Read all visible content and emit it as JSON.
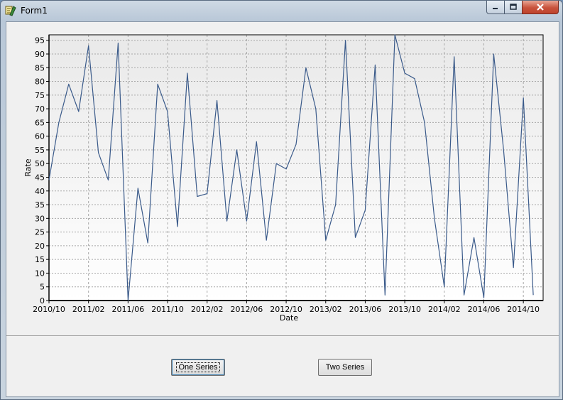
{
  "window": {
    "title": "Form1"
  },
  "buttons": {
    "one_series": "One Series",
    "two_series": "Two Series"
  },
  "colors": {
    "series": "#3a5a8a",
    "grid": "#a8a8a8",
    "plot_bg_top": "#e9e9e9",
    "plot_bg_bottom": "#ffffff"
  },
  "chart_data": {
    "type": "line",
    "title": "",
    "xlabel": "Date",
    "ylabel": "Rate",
    "ylim": [
      0,
      97
    ],
    "xlim": [
      "2010-10",
      "2014-12"
    ],
    "yticks": [
      0,
      5,
      10,
      15,
      20,
      25,
      30,
      35,
      40,
      45,
      50,
      55,
      60,
      65,
      70,
      75,
      80,
      85,
      90,
      95
    ],
    "xticks": [
      "2010/10",
      "2011/02",
      "2011/06",
      "2011/10",
      "2012/02",
      "2012/06",
      "2012/10",
      "2013/02",
      "2013/06",
      "2013/10",
      "2014/02",
      "2014/06",
      "2014/10"
    ],
    "grid": true,
    "legend": "none",
    "series": [
      {
        "x": [
          "2010-10",
          "2010-11",
          "2010-12",
          "2011-01",
          "2011-02",
          "2011-03",
          "2011-04",
          "2011-05",
          "2011-06",
          "2011-07",
          "2011-08",
          "2011-09",
          "2011-10",
          "2011-11",
          "2011-12",
          "2012-01",
          "2012-02",
          "2012-03",
          "2012-04",
          "2012-05",
          "2012-06",
          "2012-07",
          "2012-08",
          "2012-09",
          "2012-10",
          "2012-11",
          "2012-12",
          "2013-01",
          "2013-02",
          "2013-03",
          "2013-04",
          "2013-05",
          "2013-06",
          "2013-07",
          "2013-08",
          "2013-09",
          "2013-10",
          "2013-11",
          "2013-12",
          "2014-01",
          "2014-02",
          "2014-03",
          "2014-04",
          "2014-05",
          "2014-06",
          "2014-07",
          "2014-08",
          "2014-09",
          "2014-10",
          "2014-11"
        ],
        "values": [
          44,
          65,
          79,
          69,
          93,
          54,
          44,
          94,
          0,
          41,
          21,
          79,
          69,
          27,
          83,
          38,
          39,
          73,
          29,
          55,
          29,
          58,
          22,
          50,
          48,
          57,
          85,
          70,
          22,
          35,
          95,
          23,
          33,
          86,
          2,
          97,
          83,
          81,
          65,
          30,
          5,
          89,
          2,
          23,
          1,
          90,
          55,
          12,
          74,
          2
        ]
      }
    ]
  }
}
